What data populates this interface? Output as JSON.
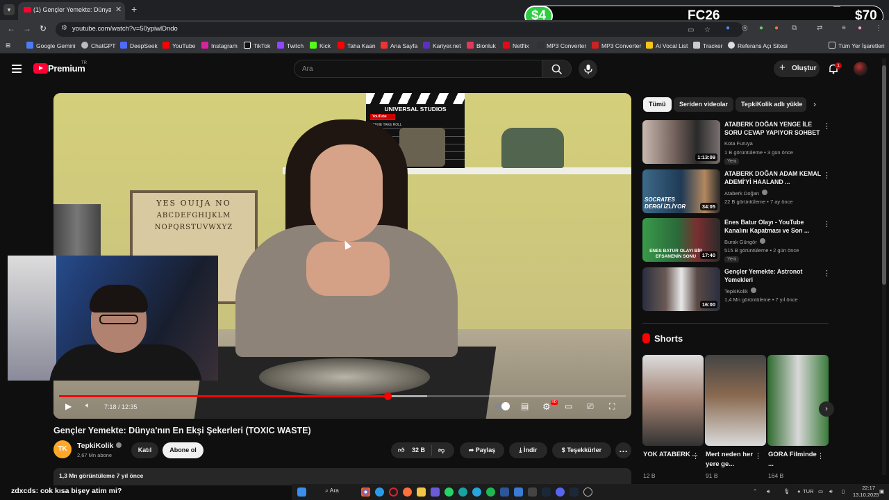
{
  "browser": {
    "tab_title": "(1) Gençler Yemekte: Dünya'nın",
    "url": "youtube.com/watch?v=50ypiwlDndo",
    "bookmarks": [
      "Google Gemini",
      "ChatGPT",
      "DeepSeek",
      "YouTube",
      "Instagram",
      "TikTok",
      "Twitch",
      "Kick",
      "Taha Kaan",
      "Ana Sayfa",
      "Kariyer.net",
      "Bionluk",
      "Netflix",
      "MP3 Converter",
      "MP3 Converter",
      "Ai Vocal List",
      "Tracker",
      "Referans Açı Sitesi"
    ],
    "all_bookmarks": "Tüm Yer İşaretleri"
  },
  "overlay": {
    "left_money": "$4",
    "center_text": "FC26",
    "right_money": "$70"
  },
  "youtube": {
    "logo_text": "Premium",
    "region": "TR",
    "search_placeholder": "Ara",
    "create_label": "Oluştur",
    "notif_count": "1"
  },
  "player": {
    "time": "7:18 / 12:35",
    "progress_fraction": 0.58,
    "buffered_fraction": 0.65,
    "clapper_title": "UNIVERSAL STUDIOS",
    "clapper_badge": "YouTube",
    "clapper_rows": [
      "PROD.",
      "SCENE TAKE ROLL",
      "DATE",
      "DIRECTOR",
      "CAMERA"
    ],
    "ouija_title": "YES  OUIJA  NO",
    "ouija_row1": "ABCDEFGHIJKLM",
    "ouija_row2": "NOPQRSTUVWXYZ"
  },
  "video": {
    "title": "Gençler Yemekte: Dünya'nın En Ekşi Şekerleri (TOXIC WASTE)",
    "channel": "TepkiKolik",
    "channel_initials": "TK",
    "subscribers": "2,67 Mn abone",
    "join_label": "Katıl",
    "subscribe_label": "Abone ol",
    "likes": "32 B",
    "share_label": "Paylaş",
    "download_label": "İndir",
    "thanks_label": "Teşekkürler",
    "views_date": "1,3 Mn görüntüleme  7 yıl önce"
  },
  "sidebar": {
    "chips": [
      "Tümü",
      "Seriden videolar",
      "TepkiKolik adlı yükle"
    ],
    "recommendations": [
      {
        "title": "ATABERK DOĞAN YENGE İLE SORU CEVAP YAPIYOR SOHBET",
        "channel": "Kota Furuya",
        "meta": "1 B görüntüleme • 3 gün önce",
        "badge": "Yeni",
        "duration": "1:13:09"
      },
      {
        "title": "ATABERK DOĞAN ADAM KEMAL ADEMİ'Yİ HAALAND ...",
        "channel": "Ataberk Doğan",
        "meta": "22 B görüntüleme • 7 ay önce",
        "badge": "",
        "duration": "34:05",
        "thumb_text": "SOCRATES DERGİ İZLİYOR"
      },
      {
        "title": "Enes Batur Olayı - YouTube Kanalını Kapatması ve Son ...",
        "channel": "Burak Güngör",
        "meta": "515 B görüntüleme • 2 gün önce",
        "badge": "Yeni",
        "duration": "17:40",
        "thumb_text": "ENES BATUR OLAYI BİR EFSANENİN SONU"
      },
      {
        "title": "Gençler Yemekte: Astronot Yemekleri",
        "channel": "TepkiKolik",
        "meta": "1,4 Mn görüntüleme • 7 yıl önce",
        "badge": "",
        "duration": "16:00"
      }
    ],
    "shorts_title": "Shorts",
    "shorts": [
      {
        "title": "YOK ATABERK ...",
        "views": "12 B"
      },
      {
        "title": "Mert neden her yere ge...",
        "views": "91 B"
      },
      {
        "title": "GORA Filminde ...",
        "views": "164 B"
      }
    ]
  },
  "chat": {
    "user": "zdxcds",
    "message": ": cok kısa bişey atim mi?"
  },
  "taskbar": {
    "search": "Ara",
    "lang": "TUR",
    "time": "22:17",
    "date": "13.10.2025"
  },
  "colors": {
    "accent": "#ff0033",
    "background": "#0f0f0f",
    "surface": "#272727",
    "overlay_green": "#2ecc40"
  }
}
